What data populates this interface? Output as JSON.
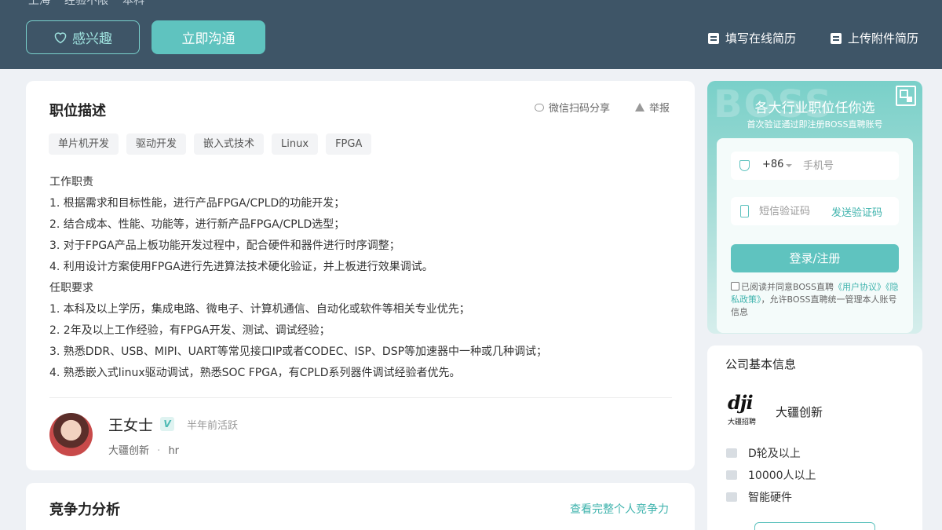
{
  "header": {
    "strip_items": [
      "上海",
      "经验不限",
      "本科"
    ],
    "interest_label": "感兴趣",
    "chat_label": "立即沟通",
    "online_resume_label": "填写在线简历",
    "upload_resume_label": "上传附件简历"
  },
  "job": {
    "title": "职位描述",
    "share_label": "微信扫码分享",
    "report_label": "举报",
    "tags": [
      "单片机开发",
      "驱动开发",
      "嵌入式技术",
      "Linux",
      "FPGA"
    ],
    "description": [
      "工作职责",
      "1. 根据需求和目标性能，进行产品FPGA/CPLD的功能开发；",
      "2. 结合成本、性能、功能等，进行新产品FPGA/CPLD选型；",
      "3. 对于FPGA产品上板功能开发过程中，配合硬件和器件进行时序调整；",
      "4. 利用设计方案使用FPGA进行先进算法技术硬化验证，并上板进行效果调试。",
      "任职要求",
      "1. 本科及以上学历，集成电路、微电子、计算机通信、自动化或软件等相关专业优先；",
      "2. 2年及以上工作经验，有FPGA开发、测试、调试经验；",
      "3. 熟悉DDR、USB、MIPI、UART等常见接口IP或者CODEC、ISP、DSP等加速器中一种或几种调试；",
      "4. 熟悉嵌入式linux驱动调试，熟悉SOC FPGA，有CPLD系列器件调试经验者优先。"
    ],
    "recruiter": {
      "name": "王女士",
      "badge": "V",
      "active": "半年前活跃",
      "company": "大疆创新",
      "sep": "·",
      "role": "hr"
    }
  },
  "competitiveness": {
    "title": "竞争力分析",
    "link": "查看完整个人竞争力"
  },
  "login": {
    "watermark": "BOSS",
    "title": "各大行业职位任你选",
    "subtitle": "首次验证通过即注册BOSS直聘账号",
    "country_code": "+86",
    "phone_placeholder": "手机号",
    "code_placeholder": "短信验证码",
    "send_code": "发送验证码",
    "submit": "登录/注册",
    "agree_prefix": "已阅读并同意BOSS直聘",
    "agree_link1": "《用户协议》",
    "agree_link2": "《隐私政策》",
    "agree_suffix": "，允许BOSS直聘统一管理本人账号信息"
  },
  "company": {
    "title": "公司基本信息",
    "logo_text": "dji",
    "logo_sub": "大疆招聘",
    "name": "大疆创新",
    "stage": "D轮及以上",
    "size": "10000人以上",
    "industry": "智能硬件"
  },
  "colors": {
    "header_bg": "#3e5567",
    "accent": "#5fc3bf",
    "link": "#3fb3ad"
  }
}
